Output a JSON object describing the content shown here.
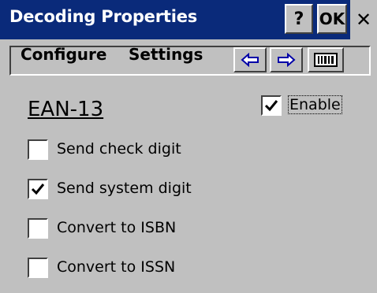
{
  "window": {
    "title": "Decoding Properties",
    "help_label": "?",
    "ok_label": "OK",
    "close_glyph": "✕"
  },
  "menu": {
    "configure_label": "Configure",
    "settings_label": "Settings"
  },
  "toolbar": {
    "back_icon": "left-arrow-icon",
    "forward_icon": "right-arrow-icon",
    "barcode_icon": "barcode-icon"
  },
  "symbology": {
    "name": "EAN-13",
    "enable_label": "Enable",
    "enable_checked": true
  },
  "options": [
    {
      "label": "Send check digit",
      "checked": false
    },
    {
      "label": "Send system digit",
      "checked": true
    },
    {
      "label": "Convert to ISBN",
      "checked": false
    },
    {
      "label": "Convert to ISSN",
      "checked": false
    }
  ],
  "colors": {
    "titlebar": "#0a2a7a",
    "face": "#c0c0c0",
    "arrow": "#0000a8"
  }
}
